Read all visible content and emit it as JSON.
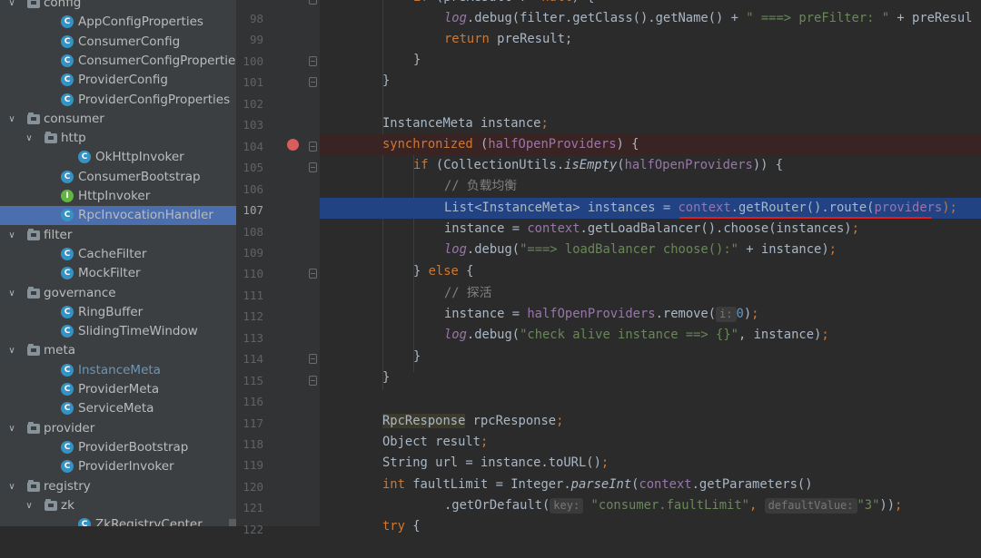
{
  "tree": {
    "items": [
      {
        "label": "config",
        "kind": "folder",
        "expanded": true
      },
      {
        "label": "AppConfigProperties",
        "kind": "class"
      },
      {
        "label": "ConsumerConfig",
        "kind": "class"
      },
      {
        "label": "ConsumerConfigProperties",
        "kind": "class"
      },
      {
        "label": "ProviderConfig",
        "kind": "class"
      },
      {
        "label": "ProviderConfigProperties",
        "kind": "class"
      },
      {
        "label": "consumer",
        "kind": "folder",
        "expanded": true
      },
      {
        "label": "http",
        "kind": "folder",
        "expanded": true
      },
      {
        "label": "OkHttpInvoker",
        "kind": "class"
      },
      {
        "label": "ConsumerBootstrap",
        "kind": "class"
      },
      {
        "label": "HttpInvoker",
        "kind": "interface"
      },
      {
        "label": "RpcInvocationHandler",
        "kind": "class",
        "selected": true
      },
      {
        "label": "filter",
        "kind": "folder",
        "expanded": true
      },
      {
        "label": "CacheFilter",
        "kind": "class"
      },
      {
        "label": "MockFilter",
        "kind": "class"
      },
      {
        "label": "governance",
        "kind": "folder",
        "expanded": true
      },
      {
        "label": "RingBuffer",
        "kind": "class"
      },
      {
        "label": "SlidingTimeWindow",
        "kind": "class"
      },
      {
        "label": "meta",
        "kind": "folder",
        "expanded": true
      },
      {
        "label": "InstanceMeta",
        "kind": "class",
        "dim": true
      },
      {
        "label": "ProviderMeta",
        "kind": "class"
      },
      {
        "label": "ServiceMeta",
        "kind": "class"
      },
      {
        "label": "provider",
        "kind": "folder",
        "expanded": true
      },
      {
        "label": "ProviderBootstrap",
        "kind": "class"
      },
      {
        "label": "ProviderInvoker",
        "kind": "class"
      },
      {
        "label": "registry",
        "kind": "folder",
        "expanded": true
      },
      {
        "label": "zk",
        "kind": "folder",
        "expanded": true
      },
      {
        "label": "ZkRegistryCenter",
        "kind": "class"
      }
    ]
  },
  "editor": {
    "line_numbers": [
      "98",
      "99",
      "100",
      "101",
      "102",
      "103",
      "104",
      "105",
      "106",
      "107",
      "108",
      "109",
      "110",
      "111",
      "112",
      "113",
      "114",
      "115",
      "116",
      "117",
      "118",
      "119",
      "120",
      "121",
      "122"
    ],
    "current_line": "107",
    "breakpoint_line": "104",
    "code": {
      "l97": "if (preResult != null) {",
      "l98a": "log",
      "l98b": ".debug(filter.getClass().getName() + ",
      "l98c": "\" ===> preFilter: \"",
      "l98d": " + preResul",
      "l99a": "return",
      "l99b": " preResult;",
      "l100": "}",
      "l101": "}",
      "l103a": "InstanceMeta instance",
      "l103b": ";",
      "l104a": "synchronized",
      "l104b": " (",
      "l104c": "halfOpenProviders",
      "l104d": ") {",
      "l105a": "if",
      "l105b": " (CollectionUtils.",
      "l105c": "isEmpty",
      "l105d": "(",
      "l105e": "halfOpenProviders",
      "l105f": ")) {",
      "l106": "// 负载均衡",
      "l107a": "List<InstanceMeta> instances = ",
      "l107b": "context",
      "l107c": ".getRouter().route(",
      "l107d": "providers",
      "l107e": ");",
      "l108a": "instance = ",
      "l108b": "context",
      "l108c": ".getLoadBalancer().choose(instances)",
      "l108d": ";",
      "l109a": "log",
      "l109b": ".debug(",
      "l109c": "\"===> loadBalancer choose():\"",
      "l109d": " + instance)",
      "l109e": ";",
      "l110a": "} ",
      "l110b": "else",
      "l110c": " {",
      "l111": "// 探活",
      "l112a": "instance = ",
      "l112b": "halfOpenProviders",
      "l112c": ".remove(",
      "l112hint": "i:",
      "l112d": "0",
      "l112e": ")",
      "l112f": ";",
      "l113a": "log",
      "l113b": ".debug(",
      "l113c": "\"check alive instance ==> {}\"",
      "l113d": ", instance)",
      "l113e": ";",
      "l114": "}",
      "l115": "}",
      "l117a": "RpcResponse",
      "l117b": " rpcResponse",
      "l117c": ";",
      "l118a": "Object result",
      "l118b": ";",
      "l119a": "String url = instance.toURL()",
      "l119b": ";",
      "l120a": "int",
      "l120b": " faultLimit = Integer.",
      "l120c": "parseInt",
      "l120d": "(",
      "l120e": "context",
      "l120f": ".getParameters()",
      "l121a": ".getOrDefault(",
      "l121hint1": "key:",
      "l121b": "\"consumer.faultLimit\"",
      "l121c": ",",
      "l121hint2": "defaultValue:",
      "l121d": "\"3\"",
      "l121e": "))",
      "l121f": ";",
      "l122a": "try",
      "l122b": " {"
    }
  },
  "colors": {
    "selection": "#4b6eaf",
    "current_line": "#214283",
    "breakpoint": "#db5c5c",
    "underline": "#e0201f"
  }
}
